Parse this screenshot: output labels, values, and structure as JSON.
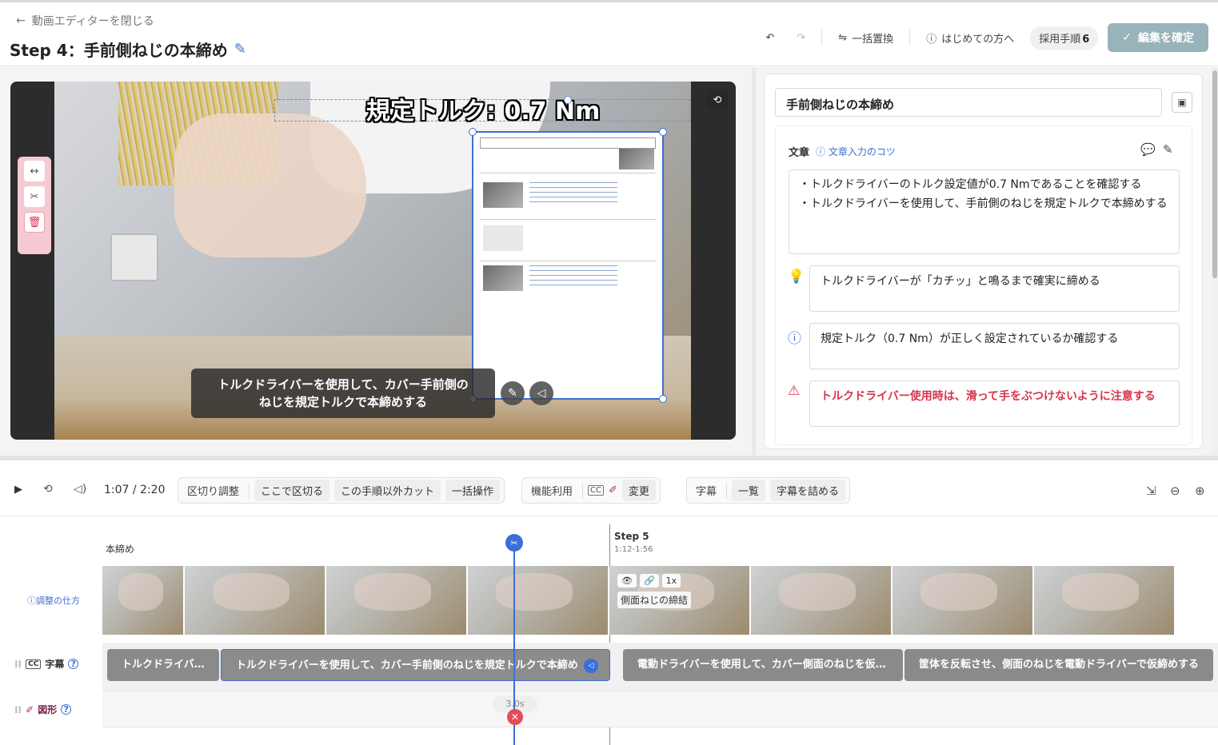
{
  "header": {
    "back_label": "動画エディターを閉じる",
    "title": "Step 4：手前側ねじの本締め",
    "replace_label": "一括置換",
    "help_label": "はじめての方へ",
    "steps_chip": "採用手順",
    "steps_count": "6",
    "confirm_label": "編集を確定"
  },
  "video": {
    "overlay_text": "規定トルク: 0.7 Nm",
    "subtitle_line1": "トルクドライバーを使用して、カバー手前側の",
    "subtitle_line2": "ねじを規定トルクで本締めする"
  },
  "panel": {
    "step_name": "手前側ねじの本締め",
    "text_label": "文章",
    "text_tip": "文章入力のコツ",
    "text_line1": "・トルクドライバーのトルク設定値が0.7 Nmであることを確認する",
    "text_line2": "・トルクドライバーを使用して、手前側のねじを規定トルクで本締めする",
    "tip_note": "トルクドライバーが「カチッ」と鳴るまで確実に締める",
    "info_note": "規定トルク（0.7 Nm）が正しく設定されているか確認する",
    "warn_note": "トルクドライバー使用時は、滑って手をぶつけないように注意する",
    "warn_color": "#d8344b",
    "accent_color": "#3b6fd8"
  },
  "controls": {
    "time": "1:07 / 2:20",
    "split_group_label": "区切り調整",
    "split_here": "ここで区切る",
    "cut_others": "この手順以外カット",
    "bulk_ops": "一括操作",
    "feature_label": "機能利用",
    "cc_label": "CC",
    "change": "変更",
    "caption_label": "字幕",
    "list": "一覧",
    "compact_captions": "字幕を詰める"
  },
  "timeline": {
    "next_step_title": "Step 5",
    "next_step_time": "1:12-1:56",
    "adjust_help": "調整の仕方",
    "frame_label_prev": "本締め",
    "frame_label_next": "側面ねじの締結",
    "speed": "1x",
    "caption_track_label": "字幕",
    "shape_track_label": "図形",
    "shape_duration": "3.0s",
    "captions": [
      "トルクドライバ…",
      "トルクドライバーを使用して、カバー手前側のねじを規定トルクで本締め",
      "電動ドライバーを使用して、カバー側面のねじを仮…",
      "筐体を反転させ、側面のねじを電動ドライバーで仮締めする"
    ]
  }
}
